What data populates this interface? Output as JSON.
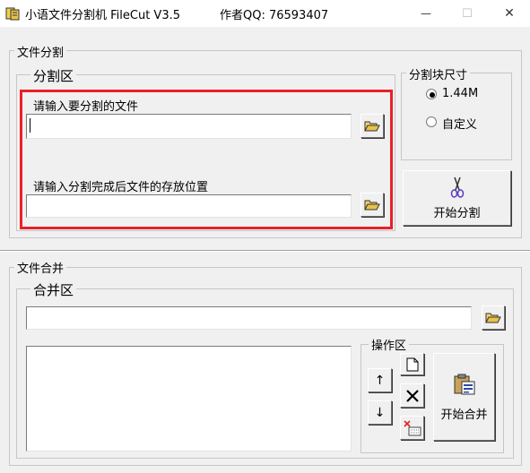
{
  "window": {
    "title": "小语文件分割机 FileCut V3.5",
    "author": "作者QQ:  76593407",
    "minimize_glyph": "—",
    "maximize_glyph": "☐",
    "close_glyph": "✕"
  },
  "split": {
    "group_label": "文件分割",
    "area_label": "分割区",
    "input_file_label": "请输入要分割的文件",
    "input_file_value": "",
    "output_label": "请输入分割完成后文件的存放位置",
    "output_value": "",
    "size_group_label": "分割块尺寸",
    "size_options": [
      {
        "label": "1.44M",
        "selected": true
      },
      {
        "label": "自定义",
        "selected": false
      }
    ],
    "start_button": "开始分割"
  },
  "merge": {
    "group_label": "文件合并",
    "area_label": "合并区",
    "path_value": "",
    "ops_label": "操作区",
    "up_glyph": "↑",
    "down_glyph": "↓",
    "start_button": "开始合并"
  },
  "icons": {
    "folder": "folder-open-icon",
    "scissors": "scissors-icon",
    "new_file": "new-file-icon",
    "delete": "delete-x-icon",
    "clear": "clear-list-icon",
    "merge": "clipboard-merge-icon"
  },
  "colors": {
    "window_bg": "#f0f0f0",
    "highlight": "#e8202a",
    "folder_yellow": "#e8c24a"
  }
}
